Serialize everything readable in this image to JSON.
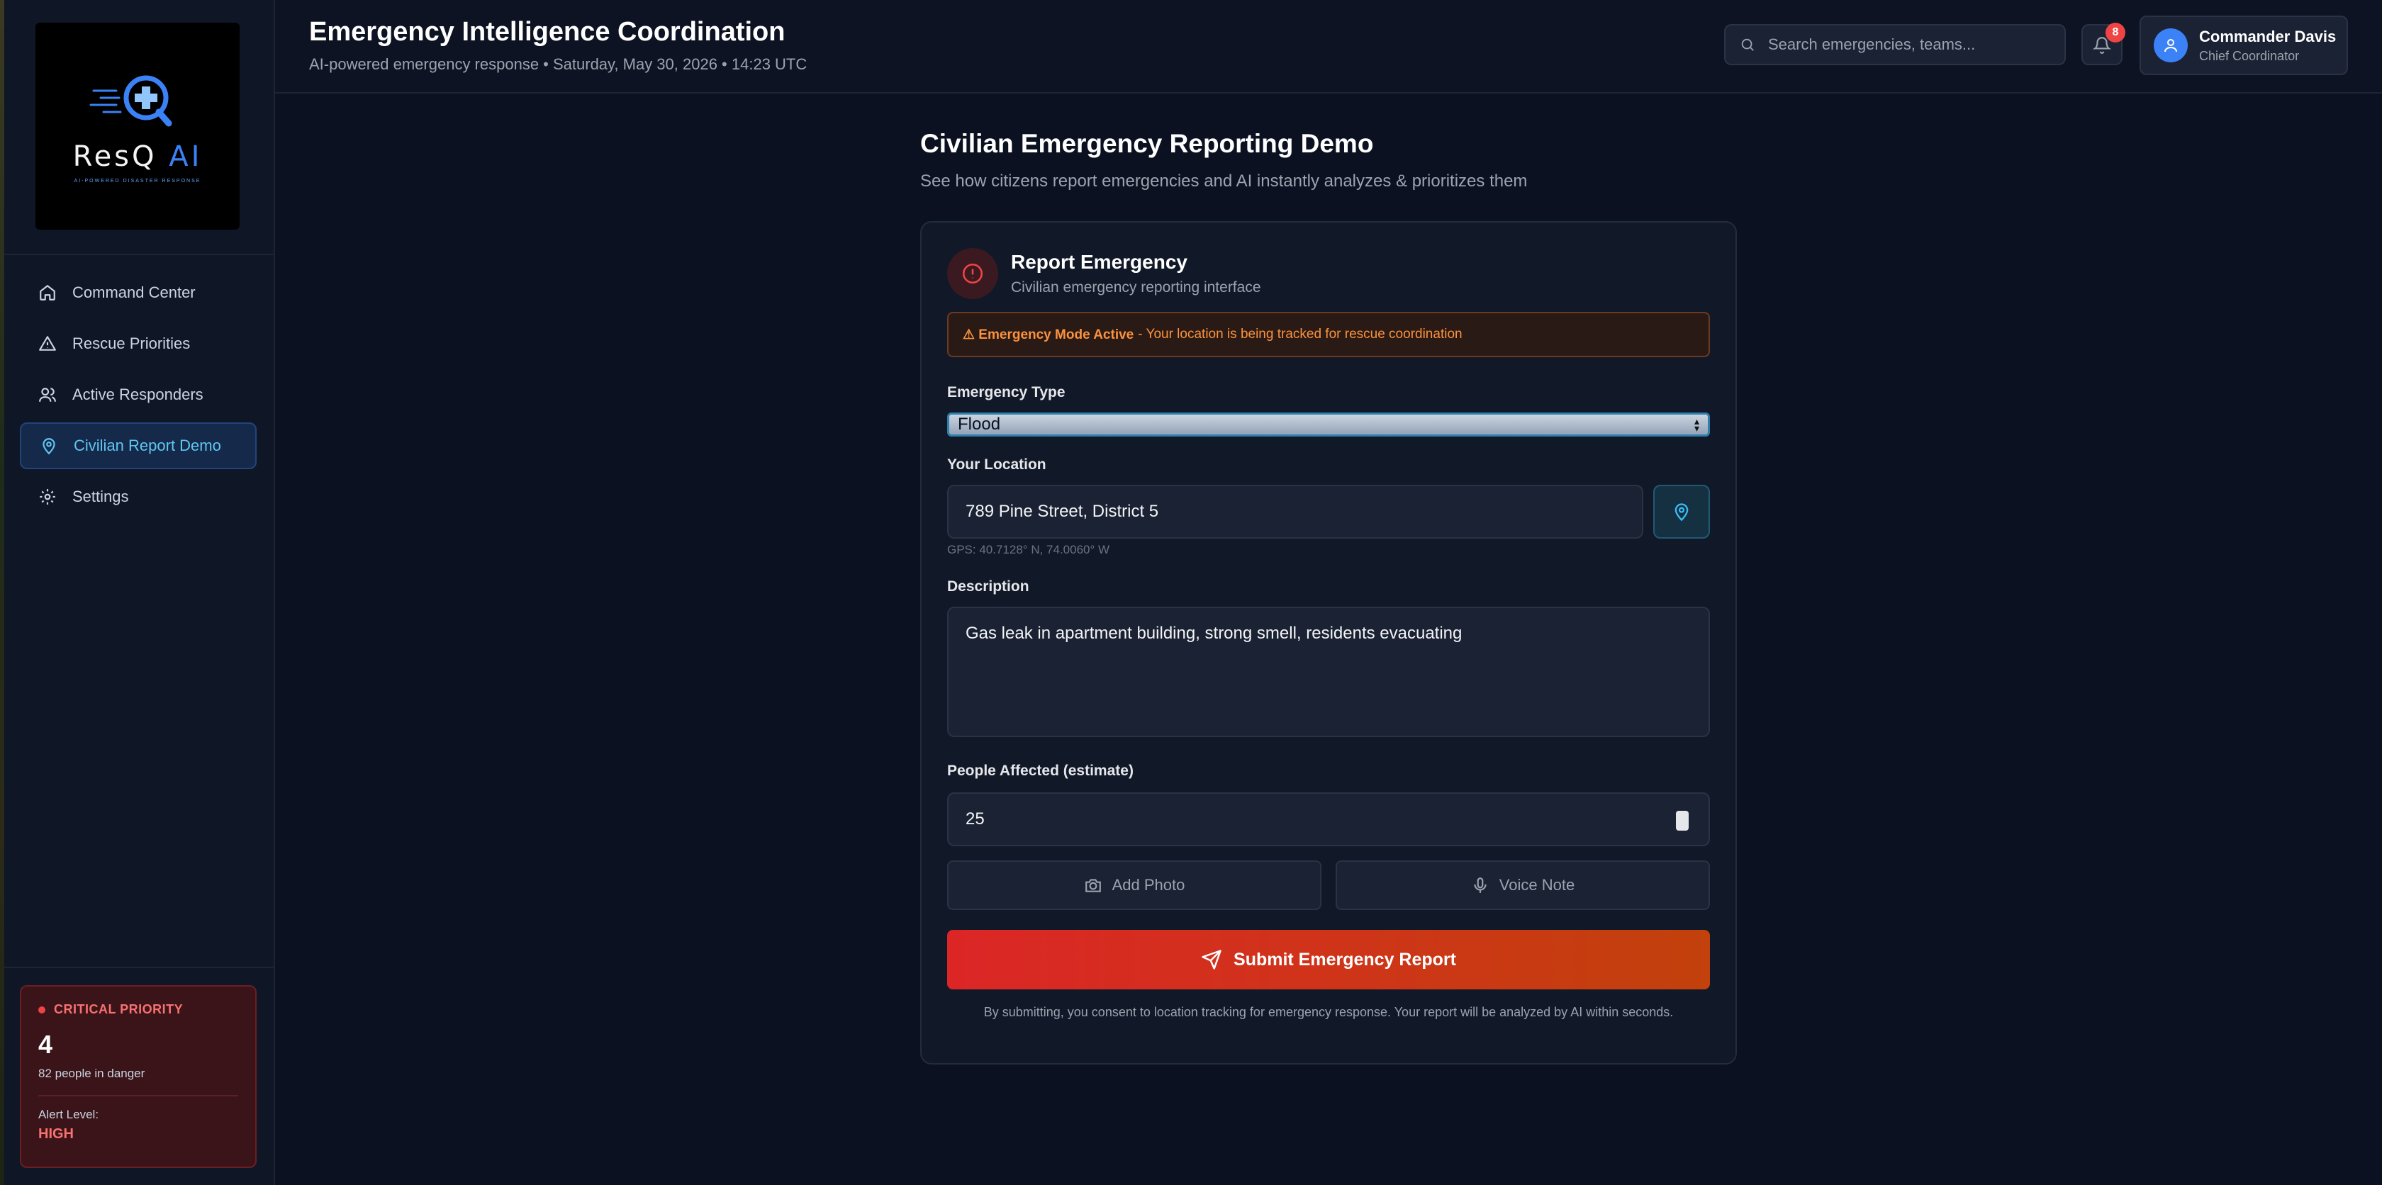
{
  "app": {
    "logo_word": "ResQ",
    "logo_word_accent": "AI",
    "logo_tagline": "AI-POWERED DISASTER RESPONSE"
  },
  "sidebar": {
    "items": [
      {
        "label": "Command Center",
        "icon": "home-icon"
      },
      {
        "label": "Rescue Priorities",
        "icon": "warning-triangle-icon"
      },
      {
        "label": "Active Responders",
        "icon": "users-icon"
      },
      {
        "label": "Civilian Report Demo",
        "icon": "map-pin-icon",
        "active": true
      },
      {
        "label": "Settings",
        "icon": "gear-icon"
      }
    ],
    "critical": {
      "label": "CRITICAL PRIORITY",
      "count": "4",
      "people": "82 people in danger",
      "alert_label": "Alert Level:",
      "alert_value": "HIGH"
    }
  },
  "header": {
    "title": "Emergency Intelligence Coordination",
    "subtitle": "AI-powered emergency response • Saturday, May 30, 2026 • 14:23 UTC",
    "search_placeholder": "Search emergencies, teams...",
    "notification_count": "8",
    "user_name": "Commander Davis",
    "user_role": "Chief Coordinator"
  },
  "main": {
    "title": "Civilian Emergency Reporting Demo",
    "subtitle": "See how citizens report emergencies and AI instantly analyzes & prioritizes them"
  },
  "form": {
    "title": "Report Emergency",
    "subtitle": "Civilian emergency reporting interface",
    "banner_bold": "⚠ Emergency Mode Active",
    "banner_text": "- Your location is being tracked for rescue coordination",
    "type_label": "Emergency Type",
    "type_value": "Flood",
    "location_label": "Your Location",
    "location_value": "789 Pine Street, District 5",
    "gps": "GPS: 40.7128° N, 74.0060° W",
    "description_label": "Description",
    "description_value": "Gas leak in apartment building, strong smell, residents evacuating",
    "people_label": "People Affected (estimate)",
    "people_value": "25",
    "photo_label": "Add Photo",
    "voice_label": "Voice Note",
    "submit_label": "Submit Emergency Report",
    "consent": "By submitting, you consent to location tracking for emergency response. Your report will be analyzed by AI within seconds."
  },
  "colors": {
    "background": "#0b1120",
    "accent": "#3b82f6",
    "danger": "#ef4444",
    "warning": "#fb923c"
  }
}
